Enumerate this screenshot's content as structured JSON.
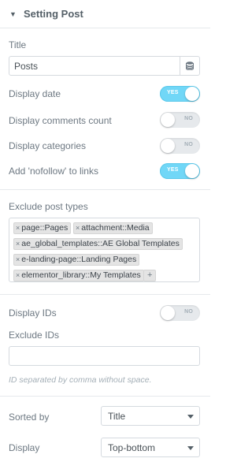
{
  "section": {
    "title": "Setting Post",
    "caret": "▼"
  },
  "title_field": {
    "label": "Title",
    "value": "Posts",
    "icon": "database-icon"
  },
  "toggles": [
    {
      "label": "Display date",
      "state": "YES",
      "on": true
    },
    {
      "label": "Display comments count",
      "state": "NO",
      "on": false
    },
    {
      "label": "Display categories",
      "state": "NO",
      "on": false
    },
    {
      "label": "Add 'nofollow' to links",
      "state": "YES",
      "on": true
    }
  ],
  "exclude_post_types": {
    "label": "Exclude post types",
    "chips": [
      "page::Pages",
      "attachment::Media",
      "ae_global_templates::AE Global Templates",
      "e-landing-page::Landing Pages",
      "elementor_library::My Templates"
    ],
    "remove_glyph": "×",
    "add_glyph": "+"
  },
  "display_ids": {
    "label": "Display IDs",
    "state": "NO",
    "on": false
  },
  "exclude_ids": {
    "label": "Exclude IDs",
    "value": "",
    "hint": "ID separated by comma without space."
  },
  "sorted_by": {
    "label": "Sorted by",
    "value": "Title"
  },
  "display": {
    "label": "Display",
    "value": "Top-bottom"
  },
  "colors": {
    "switch_on": "#71d7f7",
    "switch_off": "#e6e9ec",
    "label": "#6d7882",
    "border": "#d5dadf"
  }
}
